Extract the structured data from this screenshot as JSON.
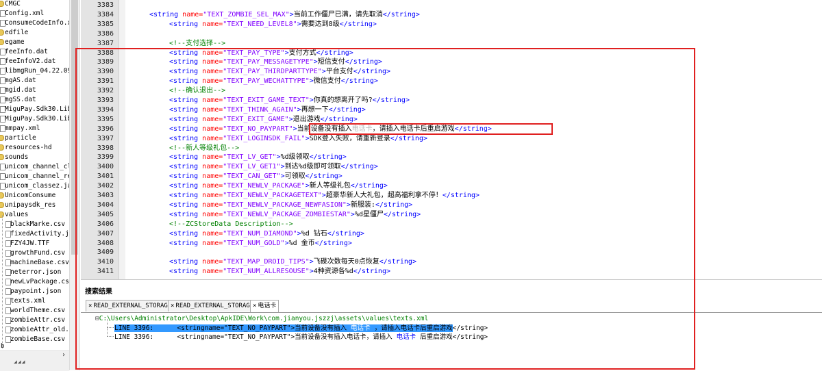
{
  "file_tree": {
    "items": [
      {
        "label": "CMGC",
        "type": "folder"
      },
      {
        "label": "Config.xml",
        "type": "file"
      },
      {
        "label": "ConsumeCodeInfo.xm",
        "type": "file"
      },
      {
        "label": "edfile",
        "type": "folder"
      },
      {
        "label": "egame",
        "type": "folder"
      },
      {
        "label": "feeInfo.dat",
        "type": "file"
      },
      {
        "label": "feeInfoV2.dat",
        "type": "file"
      },
      {
        "label": "libmgRun_04.22.09_",
        "type": "file"
      },
      {
        "label": "mgAS.dat",
        "type": "file"
      },
      {
        "label": "mgid.dat",
        "type": "file"
      },
      {
        "label": "mgSS.dat",
        "type": "file"
      },
      {
        "label": "MiguPay.Sdk30.Lib_",
        "type": "file"
      },
      {
        "label": "MiguPay.Sdk30.Lib_",
        "type": "file"
      },
      {
        "label": "mmpay.xml",
        "type": "file"
      },
      {
        "label": "particle",
        "type": "folder"
      },
      {
        "label": "resources-hd",
        "type": "folder"
      },
      {
        "label": "sounds",
        "type": "folder"
      },
      {
        "label": "unicom_channel_cls",
        "type": "file"
      },
      {
        "label": "unicom_channel_res",
        "type": "file"
      },
      {
        "label": "unicom_classez.jar",
        "type": "file"
      },
      {
        "label": "UnicomConsume",
        "type": "folder"
      },
      {
        "label": "unipaysdk_res",
        "type": "folder"
      },
      {
        "label": "values",
        "type": "folder"
      },
      {
        "label": "blackMarke.csv",
        "type": "file",
        "child": true
      },
      {
        "label": "fixedActivity.j",
        "type": "file",
        "child": true
      },
      {
        "label": "FZY4JW.TTF",
        "type": "file",
        "child": true
      },
      {
        "label": "growthFund.csv",
        "type": "file",
        "child": true
      },
      {
        "label": "machineBase.csv",
        "type": "file",
        "child": true
      },
      {
        "label": "neterror.json",
        "type": "file",
        "child": true
      },
      {
        "label": "newLvPackage.cs",
        "type": "file",
        "child": true
      },
      {
        "label": "paypoint.json",
        "type": "file",
        "child": true
      },
      {
        "label": "texts.xml",
        "type": "file",
        "child": true
      },
      {
        "label": "worldTheme.csv",
        "type": "file",
        "child": true
      },
      {
        "label": "zombieAttr.csv",
        "type": "file",
        "child": true
      },
      {
        "label": "zombieAttr_old.",
        "type": "file",
        "child": true
      },
      {
        "label": "zombieBase.csv",
        "type": "file",
        "child": true
      }
    ],
    "bottom_label": "b"
  },
  "editor": {
    "lines": [
      {
        "n": "3383",
        "indent": 0,
        "segs": []
      },
      {
        "n": "3384",
        "indent": 1,
        "segs": [
          [
            "tag",
            "<string "
          ],
          [
            "attr",
            "name="
          ],
          [
            "val",
            "\"TEXT_ZOMBIE_SEL_MAX\""
          ],
          [
            "tag",
            ">"
          ],
          [
            "txt",
            "当前工作僵尸已满，请先取消"
          ],
          [
            "tag",
            "</string>"
          ]
        ]
      },
      {
        "n": "3385",
        "indent": 2,
        "segs": [
          [
            "tag",
            "<string "
          ],
          [
            "attr",
            "name="
          ],
          [
            "val",
            "\"TEXT_NEED_LEVEL8\""
          ],
          [
            "tag",
            ">"
          ],
          [
            "txt",
            "需要达到8级"
          ],
          [
            "tag",
            "</string>"
          ]
        ]
      },
      {
        "n": "3386",
        "indent": 0,
        "segs": []
      },
      {
        "n": "3387",
        "indent": 2,
        "segs": [
          [
            "cmt",
            "<!--支付选择-->"
          ]
        ]
      },
      {
        "n": "3388",
        "indent": 2,
        "segs": [
          [
            "tag",
            "<string "
          ],
          [
            "attr",
            "name="
          ],
          [
            "val",
            "\"TEXT_PAY_TYPE\""
          ],
          [
            "tag",
            ">"
          ],
          [
            "txt",
            "支付方式"
          ],
          [
            "tag",
            "</string>"
          ]
        ]
      },
      {
        "n": "3389",
        "indent": 2,
        "segs": [
          [
            "tag",
            "<string "
          ],
          [
            "attr",
            "name="
          ],
          [
            "val",
            "\"TEXT_PAY_MESSAGETYPE\""
          ],
          [
            "tag",
            ">"
          ],
          [
            "txt",
            "短信支付"
          ],
          [
            "tag",
            "</string>"
          ]
        ]
      },
      {
        "n": "3390",
        "indent": 2,
        "segs": [
          [
            "tag",
            "<string "
          ],
          [
            "attr",
            "name="
          ],
          [
            "val",
            "\"TEXT_PAY_THIRDPARTTYPE\""
          ],
          [
            "tag",
            ">"
          ],
          [
            "txt",
            "平台支付"
          ],
          [
            "tag",
            "</string>"
          ]
        ]
      },
      {
        "n": "3391",
        "indent": 2,
        "segs": [
          [
            "tag",
            "<string "
          ],
          [
            "attr",
            "name="
          ],
          [
            "val",
            "\"TEXT_PAY_WECHATTYPE\""
          ],
          [
            "tag",
            ">"
          ],
          [
            "txt",
            "微信支付"
          ],
          [
            "tag",
            "</string>"
          ]
        ]
      },
      {
        "n": "3392",
        "indent": 2,
        "segs": [
          [
            "cmt",
            "<!--确认退出-->"
          ]
        ]
      },
      {
        "n": "3393",
        "indent": 2,
        "segs": [
          [
            "tag",
            "<string "
          ],
          [
            "attr",
            "name="
          ],
          [
            "val",
            "\"TEXT_EXIT_GAME_TEXT\""
          ],
          [
            "tag",
            ">"
          ],
          [
            "txt",
            "你真的想离开了吗?"
          ],
          [
            "tag",
            "</string>"
          ]
        ]
      },
      {
        "n": "3394",
        "indent": 2,
        "segs": [
          [
            "tag",
            "<string "
          ],
          [
            "attr",
            "name="
          ],
          [
            "val",
            "\"TEXT_THINK_AGAIN\""
          ],
          [
            "tag",
            ">"
          ],
          [
            "txt",
            "再想一下"
          ],
          [
            "tag",
            "</string>"
          ]
        ]
      },
      {
        "n": "3395",
        "indent": 2,
        "segs": [
          [
            "tag",
            "<string "
          ],
          [
            "attr",
            "name="
          ],
          [
            "val",
            "\"TEXT_EXIT_GAME\""
          ],
          [
            "tag",
            ">"
          ],
          [
            "txt",
            "退出游戏"
          ],
          [
            "tag",
            "</string>"
          ]
        ]
      },
      {
        "n": "3396",
        "indent": 2,
        "segs": [
          [
            "tag",
            "<string "
          ],
          [
            "attr",
            "name="
          ],
          [
            "val",
            "\"TEXT_NO_PAYPART\""
          ],
          [
            "tag",
            ">"
          ],
          [
            "txt",
            "当前设备没有插入"
          ],
          [
            "dim",
            "电话卡"
          ],
          [
            "txt",
            "，请插入电话卡后重启游戏"
          ],
          [
            "tag",
            "</string>"
          ]
        ]
      },
      {
        "n": "3397",
        "indent": 2,
        "segs": [
          [
            "tag",
            "<string "
          ],
          [
            "attr",
            "name="
          ],
          [
            "val",
            "\"TEXT_LOGINSDK_FAIL\""
          ],
          [
            "tag",
            ">"
          ],
          [
            "txt",
            "SDK登入失败，请重新登录"
          ],
          [
            "tag",
            "</string>"
          ]
        ]
      },
      {
        "n": "3398",
        "indent": 2,
        "segs": [
          [
            "cmt",
            "<!--新人等级礼包-->"
          ]
        ]
      },
      {
        "n": "3399",
        "indent": 2,
        "segs": [
          [
            "tag",
            "<string "
          ],
          [
            "attr",
            "name="
          ],
          [
            "val",
            "\"TEXT_LV_GET\""
          ],
          [
            "tag",
            ">"
          ],
          [
            "txt",
            "%d级领取"
          ],
          [
            "tag",
            "</string>"
          ]
        ]
      },
      {
        "n": "3400",
        "indent": 2,
        "segs": [
          [
            "tag",
            "<string "
          ],
          [
            "attr",
            "name="
          ],
          [
            "val",
            "\"TEXT_LV_GET1\""
          ],
          [
            "tag",
            ">"
          ],
          [
            "txt",
            "到达%d级即可领取"
          ],
          [
            "tag",
            "</string>"
          ]
        ]
      },
      {
        "n": "3401",
        "indent": 2,
        "segs": [
          [
            "tag",
            "<string "
          ],
          [
            "attr",
            "name="
          ],
          [
            "val",
            "\"TEXT_CAN_GET\""
          ],
          [
            "tag",
            ">"
          ],
          [
            "txt",
            "可领取"
          ],
          [
            "tag",
            "</string>"
          ]
        ]
      },
      {
        "n": "3402",
        "indent": 2,
        "segs": [
          [
            "tag",
            "<string "
          ],
          [
            "attr",
            "name="
          ],
          [
            "val",
            "\"TEXT_NEWLV_PACKAGE\""
          ],
          [
            "tag",
            ">"
          ],
          [
            "txt",
            "新人等级礼包"
          ],
          [
            "tag",
            "</string>"
          ]
        ]
      },
      {
        "n": "3403",
        "indent": 2,
        "segs": [
          [
            "tag",
            "<string "
          ],
          [
            "attr",
            "name="
          ],
          [
            "val",
            "\"TEXT_NEWLV_PACKAGETEXT\""
          ],
          [
            "tag",
            ">"
          ],
          [
            "txt",
            "超豪华新人大礼包，超高福利拿不停！"
          ],
          [
            "tag",
            "</string>"
          ]
        ]
      },
      {
        "n": "3404",
        "indent": 2,
        "segs": [
          [
            "tag",
            "<string "
          ],
          [
            "attr",
            "name="
          ],
          [
            "val",
            "\"TEXT_NEWLV_PACKAGE_NEWFASION\""
          ],
          [
            "tag",
            ">"
          ],
          [
            "txt",
            "新服装:"
          ],
          [
            "tag",
            "</string>"
          ]
        ]
      },
      {
        "n": "3405",
        "indent": 2,
        "segs": [
          [
            "tag",
            "<string "
          ],
          [
            "attr",
            "name="
          ],
          [
            "val",
            "\"TEXT_NEWLV_PACKAGE_ZOMBIESTAR\""
          ],
          [
            "tag",
            ">"
          ],
          [
            "txt",
            "%d星僵尸"
          ],
          [
            "tag",
            "</string>"
          ]
        ]
      },
      {
        "n": "3406",
        "indent": 2,
        "segs": [
          [
            "cmt",
            "<!--ZCStoreData Description-->"
          ]
        ]
      },
      {
        "n": "3407",
        "indent": 2,
        "segs": [
          [
            "tag",
            "<string "
          ],
          [
            "attr",
            "name="
          ],
          [
            "val",
            "\"TEXT_NUM_DIAMOND\""
          ],
          [
            "tag",
            ">"
          ],
          [
            "txt",
            "%d 钻石"
          ],
          [
            "tag",
            "</string>"
          ]
        ]
      },
      {
        "n": "3408",
        "indent": 2,
        "segs": [
          [
            "tag",
            "<string "
          ],
          [
            "attr",
            "name="
          ],
          [
            "val",
            "\"TEXT_NUM_GOLD\""
          ],
          [
            "tag",
            ">"
          ],
          [
            "txt",
            "%d 金币"
          ],
          [
            "tag",
            "</string>"
          ]
        ]
      },
      {
        "n": "3409",
        "indent": 0,
        "segs": []
      },
      {
        "n": "3410",
        "indent": 2,
        "segs": [
          [
            "tag",
            "<string "
          ],
          [
            "attr",
            "name="
          ],
          [
            "val",
            "\"TEXT_MAP_DROID_TIPS\""
          ],
          [
            "tag",
            ">"
          ],
          [
            "txt",
            "飞碟次数每天0点恢复"
          ],
          [
            "tag",
            "</string>"
          ]
        ]
      },
      {
        "n": "3411",
        "indent": 2,
        "segs": [
          [
            "tag",
            "<string "
          ],
          [
            "attr",
            "name="
          ],
          [
            "val",
            "\"TEXT_NUM_ALLRESOUSE\""
          ],
          [
            "tag",
            ">"
          ],
          [
            "txt",
            "4种资源各%d"
          ],
          [
            "tag",
            "</string>"
          ]
        ]
      }
    ]
  },
  "search_results": {
    "title": "搜索结果",
    "tabs": [
      {
        "label": "READ_EXTERNAL_STORAG"
      },
      {
        "label": "READ_EXTERNAL_STORAG"
      },
      {
        "label": "电话卡"
      }
    ],
    "tab_close": "×",
    "tree_toggle": "⊟",
    "file_path": "C:\\Users\\Administrator\\Desktop\\ApkIDE\\Work\\com.jianyou.jszzj\\assets\\values\\texts.xml",
    "rows": [
      {
        "line": "LINE 3396:",
        "pre": "<stringname=\"TEXT_NO_PAYPART\">当前设备没有插入",
        "hit": "电话卡",
        "post": "，请插入电话卡后重启游戏",
        "end": "</string>",
        "selected": true
      },
      {
        "line": "LINE 3396:",
        "pre": "<stringname=\"TEXT_NO_PAYPART\">当前设备没有插入电话卡，请插入",
        "hit": "电话卡",
        "post": "后重启游戏",
        "end": "</string>",
        "selected": false
      }
    ]
  },
  "colors": {
    "tag": "#0000ff",
    "attr": "#ff0000",
    "value": "#8000ff",
    "comment": "#008000",
    "annotation": "#e02020",
    "selection": "#3399ff"
  }
}
